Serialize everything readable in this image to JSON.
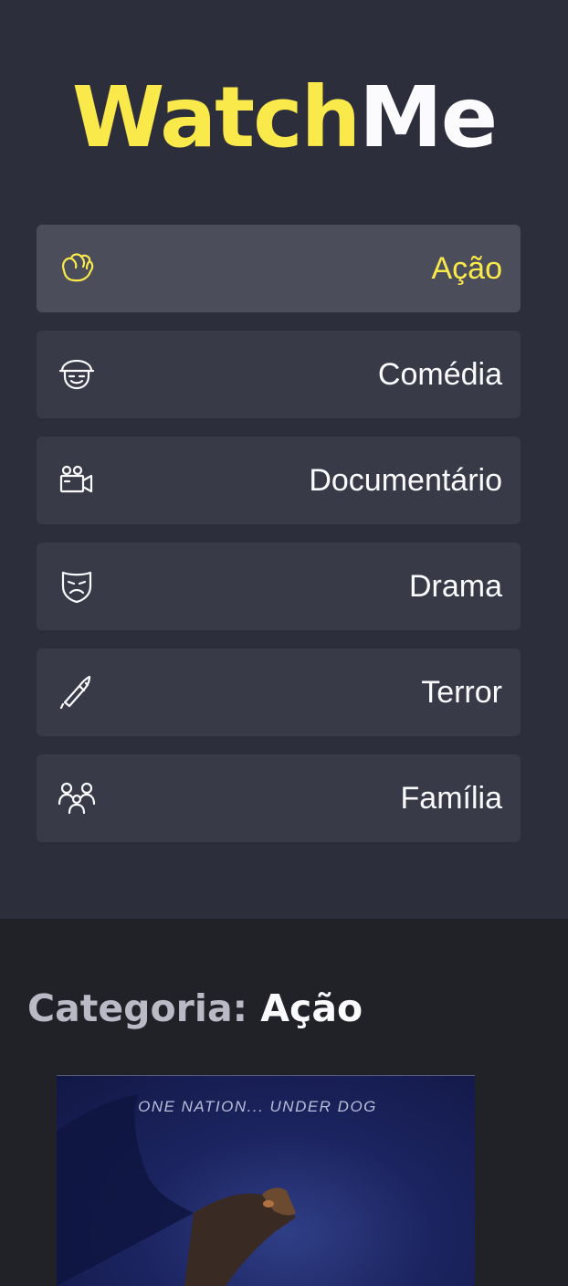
{
  "logo": {
    "part1": "Watch",
    "part2": "Me"
  },
  "genres": [
    {
      "label": "Ação",
      "icon": "fist-icon",
      "active": true
    },
    {
      "label": "Comédia",
      "icon": "clown-icon",
      "active": false
    },
    {
      "label": "Documentário",
      "icon": "video-camera-icon",
      "active": false
    },
    {
      "label": "Drama",
      "icon": "sad-mask-icon",
      "active": false
    },
    {
      "label": "Terror",
      "icon": "knife-icon",
      "active": false
    },
    {
      "label": "Família",
      "icon": "family-icon",
      "active": false
    }
  ],
  "content": {
    "category_prefix": "Categoria:",
    "category_name": "Ação",
    "poster_tagline": "ONE NATION... UNDER DOG"
  },
  "colors": {
    "accent": "#fae94b",
    "sidebar_bg": "#2d2e3b",
    "item_bg": "#393a48",
    "item_active_bg": "#4c4d5b",
    "content_bg": "#212228"
  }
}
